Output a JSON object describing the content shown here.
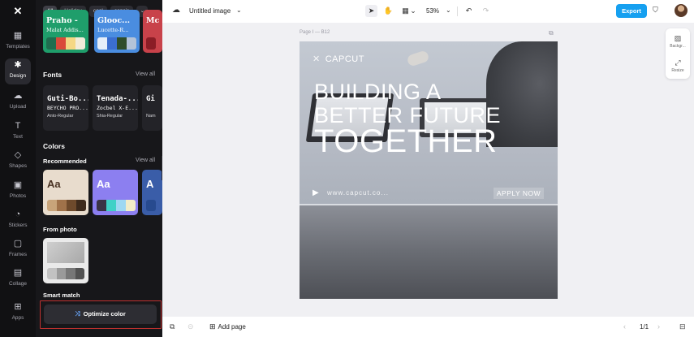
{
  "rail": {
    "items": [
      {
        "label": "Templates",
        "icon": "templates-icon",
        "glyph": "▦"
      },
      {
        "label": "Design",
        "icon": "design-icon",
        "glyph": "✱"
      },
      {
        "label": "Upload",
        "icon": "upload-icon",
        "glyph": "☁"
      },
      {
        "label": "Text",
        "icon": "text-icon",
        "glyph": "T"
      },
      {
        "label": "Shapes",
        "icon": "shapes-icon",
        "glyph": "◇"
      },
      {
        "label": "Photos",
        "icon": "photos-icon",
        "glyph": "▣"
      },
      {
        "label": "Stickers",
        "icon": "stickers-icon",
        "glyph": "◔"
      },
      {
        "label": "Frames",
        "icon": "frames-icon",
        "glyph": "▢"
      },
      {
        "label": "Collage",
        "icon": "collage-icon",
        "glyph": "▤"
      },
      {
        "label": "Apps",
        "icon": "apps-icon",
        "glyph": "⊞"
      }
    ],
    "active": "Design"
  },
  "panel": {
    "chips": [
      "All",
      "Holiday",
      "cool",
      "concis"
    ],
    "templates": [
      {
        "title": "Praho -",
        "sub": "Malat Addis...",
        "bg": "#1f9e6b",
        "fg": "#ffffff",
        "colors": [
          "#1f6e4f",
          "#d94a3a",
          "#f4d884",
          "#f2ecd9"
        ]
      },
      {
        "title": "Glooc...",
        "sub": "Lucette-R...",
        "bg": "#4a8de0",
        "fg": "#ffffff",
        "colors": [
          "#e6eef9",
          "#3b6ed0",
          "#2f4d2a",
          "#b4c3d8"
        ]
      },
      {
        "title": "Mc",
        "sub": "",
        "bg": "#c8424a",
        "fg": "#ffffff",
        "colors": [
          "#8b1d26"
        ]
      }
    ],
    "fonts_title": "Fonts",
    "fonts_view_all": "View all",
    "fonts": [
      {
        "name": "Guti-Bo...",
        "alt": "BEYCHO PRO...",
        "meta": "Anto-Regular"
      },
      {
        "name": "Tenada-...",
        "alt": "Zocbel X-E...",
        "meta": "Shia-Regular"
      },
      {
        "name": "Gi",
        "alt": "",
        "meta": "Nam"
      }
    ],
    "colors_title": "Colors",
    "recommended_label": "Recommended",
    "recommended_view_all": "View all",
    "color_cards": [
      {
        "aa": "Aa",
        "bg": "#e8dccd",
        "fg": "#4b3424",
        "colors": [
          "#c8a47a",
          "#a0724a",
          "#6e4a2c",
          "#3d2a1c"
        ]
      },
      {
        "aa": "Aa",
        "bg": "#8c7ff0",
        "fg": "#ffffff",
        "colors": [
          "#3a3346",
          "#3fd1c7",
          "#9ed8f2",
          "#f2ecc8"
        ]
      },
      {
        "aa": "A",
        "bg": "#3a5da8",
        "fg": "#ffffff",
        "colors": [
          "#274a8f"
        ]
      }
    ],
    "from_photo_label": "From photo",
    "photo_colors": [
      "#c2c2c2",
      "#9a9a9a",
      "#777777",
      "#525252"
    ],
    "smart_match_label": "Smart match",
    "optimize_label": "Optimize color"
  },
  "topbar": {
    "doc_title": "Untitled image",
    "zoom": "53%",
    "export_label": "Export"
  },
  "canvas": {
    "page_label": "Page I —  B12",
    "logo_text": "CAPCUT",
    "headline": [
      "BUILDING A",
      "BETTER FUTURE",
      "TOGETHER"
    ],
    "url_text": "www.capcut.co...",
    "cta": "APPLY NOW"
  },
  "right_panel": {
    "background_label": "Backgr...",
    "resize_label": "Resize"
  },
  "bottombar": {
    "add_page_label": "Add page",
    "pager": "1/1"
  }
}
